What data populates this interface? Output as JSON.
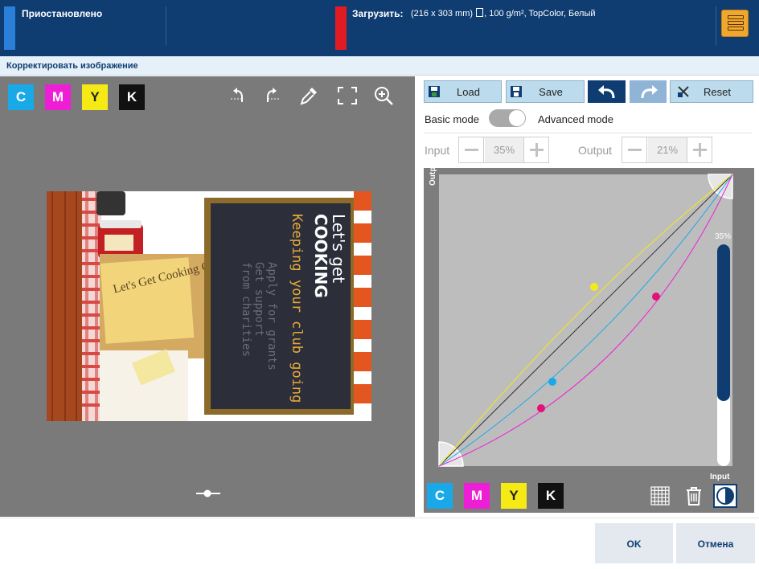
{
  "topbar": {
    "status": "Приостановлено",
    "load_label": "Загрузить:",
    "load_size": "(216 x 303 mm)",
    "load_rest": ", 100 g/m², TopColor, Белый",
    "menu_icon": "server-stack-icon",
    "status_color": "#2a7fd8",
    "load_color": "#e11b22"
  },
  "header": {
    "title": "Корректировать изображение"
  },
  "preview": {
    "channels": [
      "C",
      "M",
      "Y",
      "K"
    ],
    "tools": [
      "rotate-left-icon",
      "rotate-right-icon",
      "eyedropper-icon",
      "fullscreen-icon",
      "zoom-in-icon"
    ],
    "artwork": {
      "line1": "Let's get",
      "line2": "COOKING",
      "tagline": "Keeping your club going",
      "faint1": "Apply for grants",
      "faint2": "Get support",
      "faint3": "from charities",
      "note": "Let's Get Cooking Club"
    }
  },
  "panel": {
    "load_label": "Load",
    "save_label": "Save",
    "reset_label": "Reset",
    "basic_mode": "Basic mode",
    "advanced_mode": "Advanced mode",
    "mode_advanced_on": true,
    "input_label": "Input",
    "input_value": "35%",
    "output_label": "Output",
    "output_value": "21%",
    "curve": {
      "output_axis": "Output",
      "input_axis": "Input",
      "slider_value_label": "35%",
      "slider_level": 0.35,
      "channels": [
        "C",
        "M",
        "Y",
        "K"
      ],
      "colors": {
        "cyan": "#19a9e8",
        "magenta": "#ee1ed6",
        "yellow": "#f6ea16",
        "black": "#111111"
      }
    },
    "bottom_tools": [
      "grid-icon",
      "trash-icon",
      "contrast-icon"
    ]
  },
  "footer": {
    "ok": "OK",
    "cancel": "Отмена"
  }
}
